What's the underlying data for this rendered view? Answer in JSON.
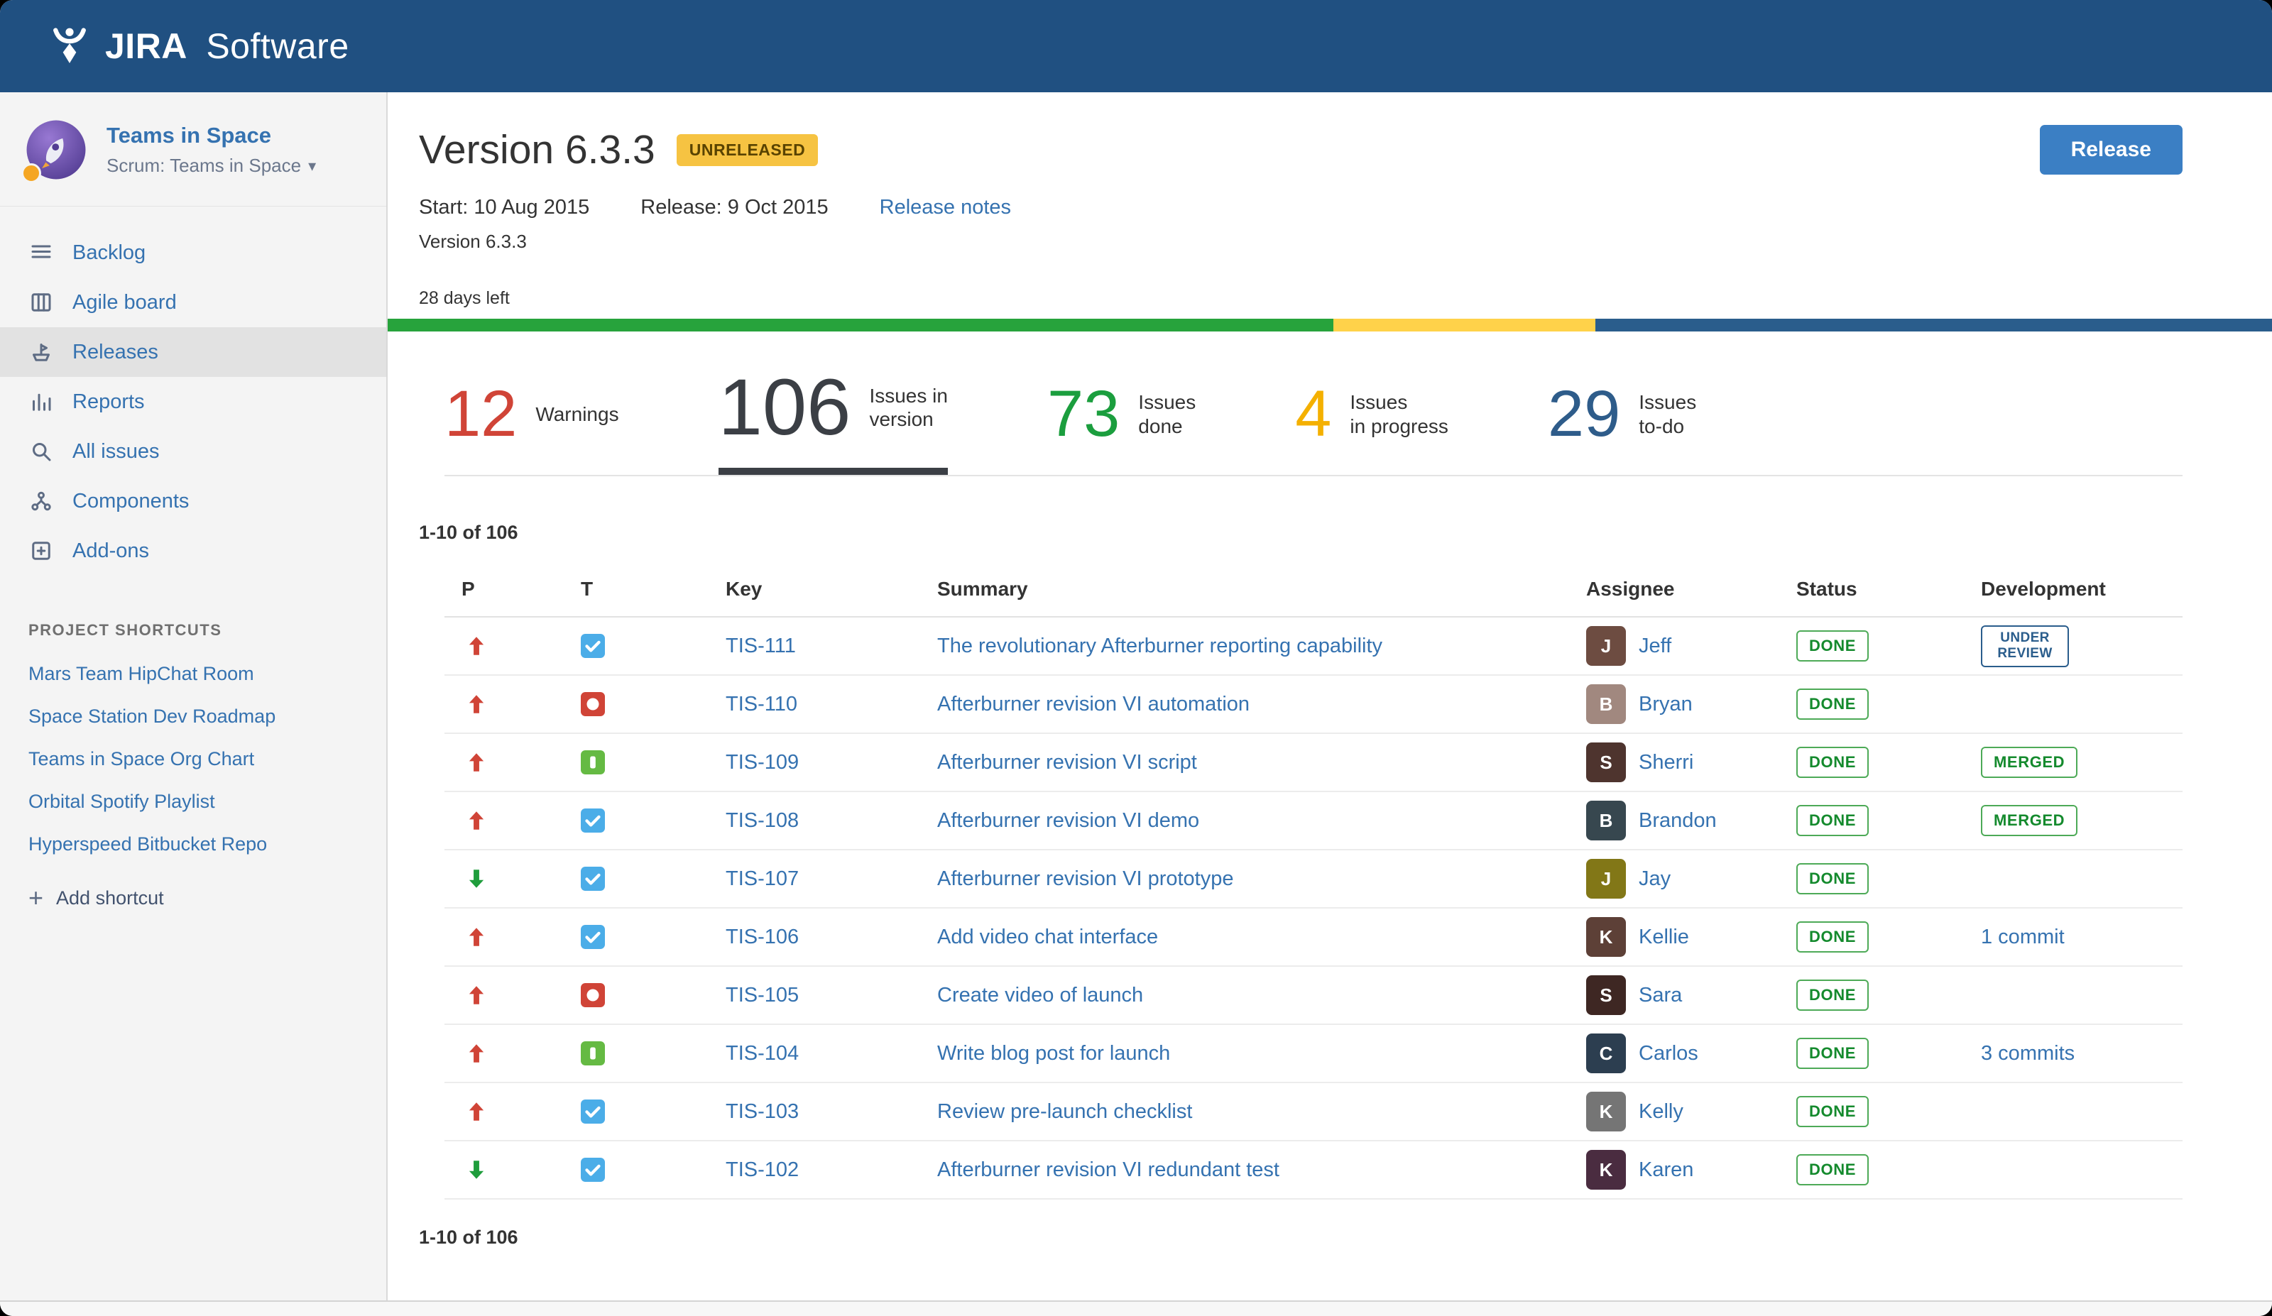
{
  "topbar": {
    "brand_primary": "JIRA",
    "brand_secondary": "Software"
  },
  "colors": {
    "topbar_blue": "#205081",
    "link_blue": "#3572b0",
    "selected_tab_underline": "#3b3f45",
    "badge_yellow": "#f6c342"
  },
  "sidebar": {
    "project": {
      "name": "Teams in Space",
      "board": "Scrum: Teams in Space"
    },
    "nav": [
      {
        "label": "Backlog",
        "icon": "backlog-icon"
      },
      {
        "label": "Agile board",
        "icon": "board-icon"
      },
      {
        "label": "Releases",
        "icon": "releases-icon",
        "selected": true
      },
      {
        "label": "Reports",
        "icon": "reports-icon"
      },
      {
        "label": "All issues",
        "icon": "all-issues-icon"
      },
      {
        "label": "Components",
        "icon": "components-icon"
      },
      {
        "label": "Add-ons",
        "icon": "addons-icon"
      }
    ],
    "shortcuts_header": "PROJECT SHORTCUTS",
    "shortcuts": [
      "Mars Team HipChat Room",
      "Space Station Dev Roadmap",
      "Teams in Space Org Chart",
      "Orbital Spotify Playlist",
      "Hyperspeed Bitbucket Repo"
    ],
    "add_shortcut": "Add shortcut"
  },
  "header": {
    "title": "Version 6.3.3",
    "status_badge": "UNRELEASED",
    "release_button": "Release",
    "start": "Start: 10 Aug 2015",
    "release_date": "Release: 9 Oct 2015",
    "release_notes": "Release notes",
    "description": "Version 6.3.3",
    "days_left": "28 days left"
  },
  "progress": {
    "segments": [
      {
        "name": "done",
        "pct": 50.2,
        "color": "#27a33c"
      },
      {
        "name": "in progress",
        "pct": 13.9,
        "color": "#ffd24a"
      },
      {
        "name": "to do",
        "pct": 35.9,
        "color": "#2a5d8c"
      }
    ]
  },
  "stats": [
    {
      "value": "12",
      "lines": [
        "Warnings"
      ],
      "color": "#d04437"
    },
    {
      "value": "106",
      "lines": [
        "Issues in",
        "version"
      ],
      "color": "#3b3f45",
      "selected": true
    },
    {
      "value": "73",
      "lines": [
        "Issues",
        "done"
      ],
      "color": "#1b9e3e"
    },
    {
      "value": "4",
      "lines": [
        "Issues",
        "in progress"
      ],
      "color": "#f4b000"
    },
    {
      "value": "29",
      "lines": [
        "Issues",
        "to-do"
      ],
      "color": "#2e5c8a"
    }
  ],
  "table": {
    "count_top": "1-10 of 106",
    "count_bottom": "1-10 of 106",
    "columns": [
      "P",
      "T",
      "Key",
      "Summary",
      "Assignee",
      "Status",
      "Development"
    ],
    "rows": [
      {
        "priority": "up",
        "type": "task",
        "key": "TIS-111",
        "summary": "The revolutionary Afterburner reporting capability",
        "assignee": {
          "name": "Jeff",
          "avatar_color": "#6d4c41"
        },
        "status": "DONE",
        "development": {
          "kind": "lozenge",
          "color": "blue",
          "label": "UNDER REVIEW"
        }
      },
      {
        "priority": "up",
        "type": "bug",
        "key": "TIS-110",
        "summary": "Afterburner revision VI automation",
        "assignee": {
          "name": "Bryan",
          "avatar_color": "#a1887f"
        },
        "status": "DONE",
        "development": null
      },
      {
        "priority": "up",
        "type": "story",
        "key": "TIS-109",
        "summary": "Afterburner revision VI script",
        "assignee": {
          "name": "Sherri",
          "avatar_color": "#4e342e"
        },
        "status": "DONE",
        "development": {
          "kind": "lozenge",
          "color": "green",
          "label": "MERGED"
        }
      },
      {
        "priority": "up",
        "type": "task",
        "key": "TIS-108",
        "summary": "Afterburner revision VI demo",
        "assignee": {
          "name": "Brandon",
          "avatar_color": "#37474f"
        },
        "status": "DONE",
        "development": {
          "kind": "lozenge",
          "color": "green",
          "label": "MERGED"
        }
      },
      {
        "priority": "down",
        "type": "task",
        "key": "TIS-107",
        "summary": "Afterburner revision VI prototype",
        "assignee": {
          "name": "Jay",
          "avatar_color": "#827717"
        },
        "status": "DONE",
        "development": null
      },
      {
        "priority": "up",
        "type": "task",
        "key": "TIS-106",
        "summary": "Add video chat interface",
        "assignee": {
          "name": "Kellie",
          "avatar_color": "#5d4037"
        },
        "status": "DONE",
        "development": {
          "kind": "link",
          "label": "1 commit"
        }
      },
      {
        "priority": "up",
        "type": "bug",
        "key": "TIS-105",
        "summary": "Create video of launch",
        "assignee": {
          "name": "Sara",
          "avatar_color": "#3e2723"
        },
        "status": "DONE",
        "development": null
      },
      {
        "priority": "up",
        "type": "story",
        "key": "TIS-104",
        "summary": "Write blog post for launch",
        "assignee": {
          "name": "Carlos",
          "avatar_color": "#2c3e50"
        },
        "status": "DONE",
        "development": {
          "kind": "link",
          "label": "3 commits"
        }
      },
      {
        "priority": "up",
        "type": "task",
        "key": "TIS-103",
        "summary": "Review pre-launch checklist",
        "assignee": {
          "name": "Kelly",
          "avatar_color": "#757575"
        },
        "status": "DONE",
        "development": null
      },
      {
        "priority": "down",
        "type": "task",
        "key": "TIS-102",
        "summary": "Afterburner revision VI redundant test",
        "assignee": {
          "name": "Karen",
          "avatar_color": "#4a2c40"
        },
        "status": "DONE",
        "development": null
      }
    ]
  }
}
